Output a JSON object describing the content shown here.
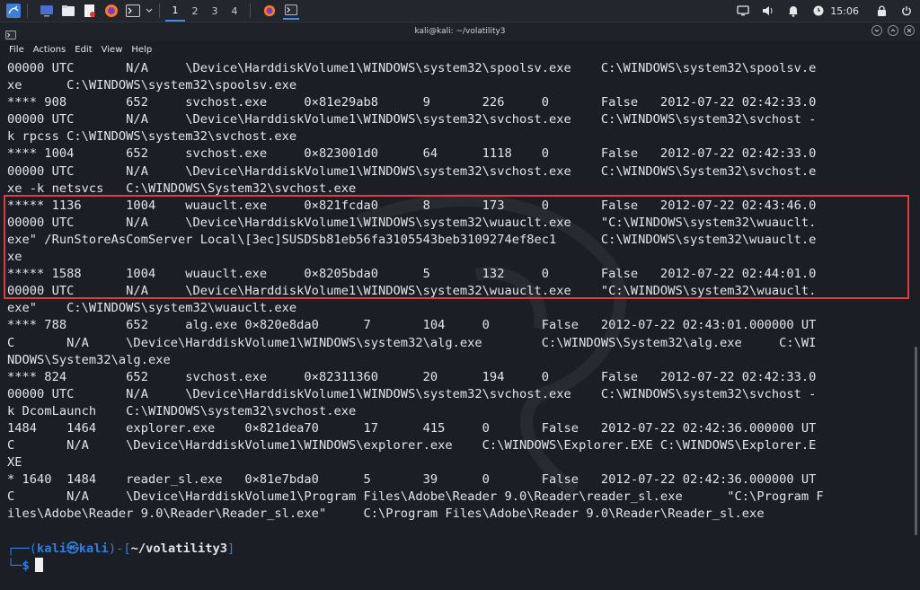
{
  "taskbar": {
    "workspaces": [
      "1",
      "2",
      "3",
      "4"
    ],
    "active_workspace": "1",
    "clock": "15:06",
    "icons": [
      "kali-menu-icon",
      "desktop-icon",
      "files-icon",
      "text-editor-icon",
      "firefox-icon",
      "terminal-icon"
    ]
  },
  "window": {
    "title": "kali@kali: ~/volatility3",
    "menu": [
      "File",
      "Actions",
      "Edit",
      "View",
      "Help"
    ]
  },
  "terminal": {
    "lines": [
      "00000 UTC       N/A     \\Device\\HarddiskVolume1\\WINDOWS\\system32\\spoolsv.exe    C:\\WINDOWS\\system32\\spoolsv.e",
      "xe      C:\\WINDOWS\\system32\\spoolsv.exe",
      "**** 908        652     svchost.exe     0×81e29ab8      9       226     0       False   2012-07-22 02:42:33.0",
      "00000 UTC       N/A     \\Device\\HarddiskVolume1\\WINDOWS\\system32\\svchost.exe    C:\\WINDOWS\\system32\\svchost -",
      "k rpcss C:\\WINDOWS\\system32\\svchost.exe",
      "**** 1004       652     svchost.exe     0×823001d0      64      1118    0       False   2012-07-22 02:42:33.0",
      "00000 UTC       N/A     \\Device\\HarddiskVolume1\\WINDOWS\\system32\\svchost.exe    C:\\WINDOWS\\System32\\svchost.e",
      "xe -k netsvcs   C:\\WINDOWS\\System32\\svchost.exe",
      "***** 1136      1004    wuauclt.exe     0×821fcda0      8       173     0       False   2012-07-22 02:43:46.0",
      "00000 UTC       N/A     \\Device\\HarddiskVolume1\\WINDOWS\\system32\\wuauclt.exe    \"C:\\WINDOWS\\system32\\wuauclt.",
      "exe\" /RunStoreAsComServer Local\\[3ec]SUSDSb81eb56fa3105543beb3109274ef8ec1      C:\\WINDOWS\\system32\\wuauclt.e",
      "xe",
      "***** 1588      1004    wuauclt.exe     0×8205bda0      5       132     0       False   2012-07-22 02:44:01.0",
      "00000 UTC       N/A     \\Device\\HarddiskVolume1\\WINDOWS\\system32\\wuauclt.exe    \"C:\\WINDOWS\\system32\\wuauclt.",
      "exe\"    C:\\WINDOWS\\system32\\wuauclt.exe",
      "**** 788        652     alg.exe 0×820e8da0      7       104     0       False   2012-07-22 02:43:01.000000 UT",
      "C       N/A     \\Device\\HarddiskVolume1\\WINDOWS\\system32\\alg.exe        C:\\WINDOWS\\System32\\alg.exe     C:\\WI",
      "NDOWS\\System32\\alg.exe",
      "**** 824        652     svchost.exe     0×82311360      20      194     0       False   2012-07-22 02:42:33.0",
      "00000 UTC       N/A     \\Device\\HarddiskVolume1\\WINDOWS\\system32\\svchost.exe    C:\\WINDOWS\\system32\\svchost -",
      "k DcomLaunch    C:\\WINDOWS\\system32\\svchost.exe",
      "1484    1464    explorer.exe    0×821dea70      17      415     0       False   2012-07-22 02:42:36.000000 UT",
      "C       N/A     \\Device\\HarddiskVolume1\\WINDOWS\\explorer.exe    C:\\WINDOWS\\Explorer.EXE C:\\WINDOWS\\Explorer.E",
      "XE",
      "* 1640  1484    reader_sl.exe   0×81e7bda0      5       39      0       False   2012-07-22 02:42:36.000000 UT",
      "C       N/A     \\Device\\HarddiskVolume1\\Program Files\\Adobe\\Reader 9.0\\Reader\\reader_sl.exe      \"C:\\Program F",
      "iles\\Adobe\\Reader 9.0\\Reader\\Reader_sl.exe\"     C:\\Program Files\\Adobe\\Reader 9.0\\Reader\\Reader_sl.exe",
      "",
      ""
    ],
    "prompt": {
      "corner_top": "┌──(",
      "user": "kali㉿kali",
      "sep": ")-[",
      "path": "~/volatility3",
      "close": "]",
      "corner_bottom": "└─",
      "dollar": "$"
    }
  },
  "colors": {
    "background": "#1b1e24",
    "text": "#e3e5e8",
    "prompt_blue": "#2f7ee0",
    "highlight_border": "#e23b3b"
  }
}
